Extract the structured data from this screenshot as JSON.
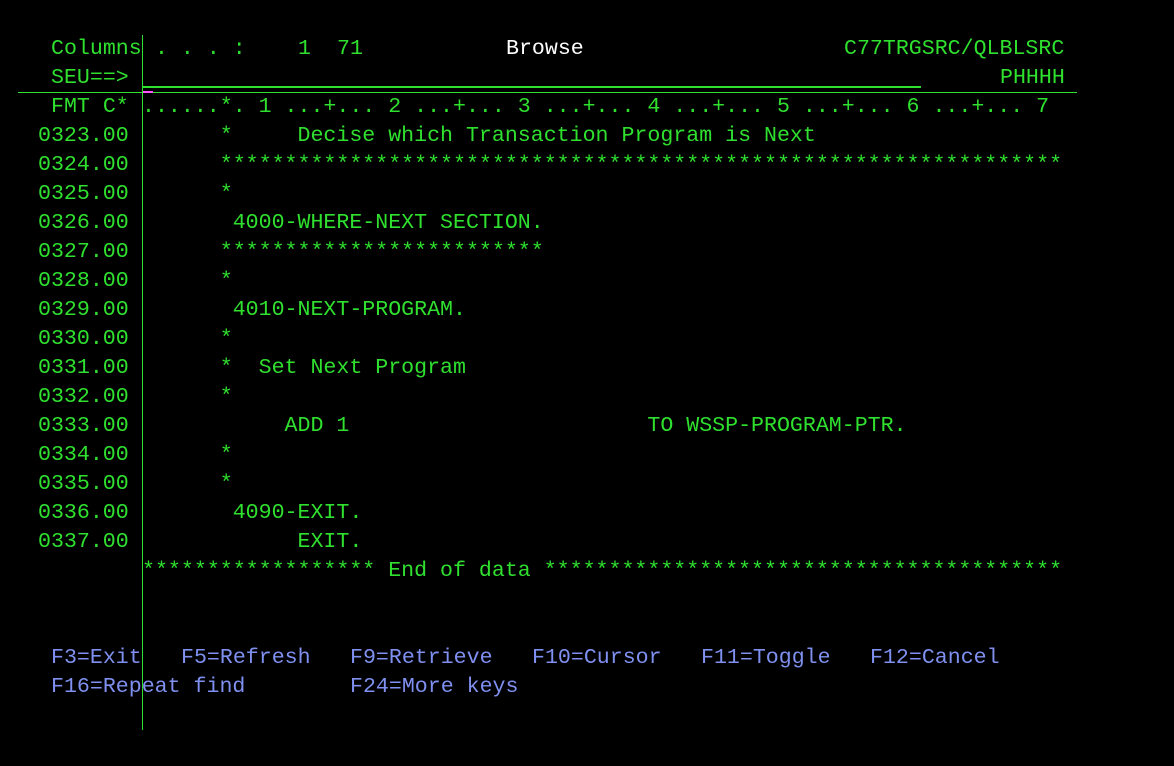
{
  "header": {
    "columns_label": "Columns",
    "columns_dots": ". . . :",
    "col_from": "1",
    "col_to": "71",
    "mode": "Browse",
    "member": "C77TRGSRC/QLBLSRC",
    "command_prompt": "SEU==>",
    "command_value": "",
    "member_name": "PHHHH",
    "fmt_label": "FMT C*",
    "ruler": "......*. 1 ...+... 2 ...+... 3 ...+... 4 ...+... 5 ...+... 6 ...+... 7"
  },
  "lines": [
    {
      "seq": "0323.00",
      "text": "      *     Decise which Transaction Program is Next"
    },
    {
      "seq": "0324.00",
      "text": "      *****************************************************************"
    },
    {
      "seq": "0325.00",
      "text": "      *"
    },
    {
      "seq": "0326.00",
      "text": "       4000-WHERE-NEXT SECTION."
    },
    {
      "seq": "0327.00",
      "text": "      *************************"
    },
    {
      "seq": "0328.00",
      "text": "      *"
    },
    {
      "seq": "0329.00",
      "text": "       4010-NEXT-PROGRAM."
    },
    {
      "seq": "0330.00",
      "text": "      *"
    },
    {
      "seq": "0331.00",
      "text": "      *  Set Next Program"
    },
    {
      "seq": "0332.00",
      "text": "      *"
    },
    {
      "seq": "0333.00",
      "text": "           ADD 1                       TO WSSP-PROGRAM-PTR."
    },
    {
      "seq": "0334.00",
      "text": "      *"
    },
    {
      "seq": "0335.00",
      "text": "      *"
    },
    {
      "seq": "0336.00",
      "text": "       4090-EXIT."
    },
    {
      "seq": "0337.00",
      "text": "            EXIT."
    }
  ],
  "end_of_data": "****************** End of data ****************************************",
  "function_keys": {
    "f3": "F3=Exit",
    "f5": "F5=Refresh",
    "f9": "F9=Retrieve",
    "f10": "F10=Cursor",
    "f11": "F11=Toggle",
    "f12": "F12=Cancel",
    "f16": "F16=Repeat find",
    "f24": "F24=More keys"
  }
}
